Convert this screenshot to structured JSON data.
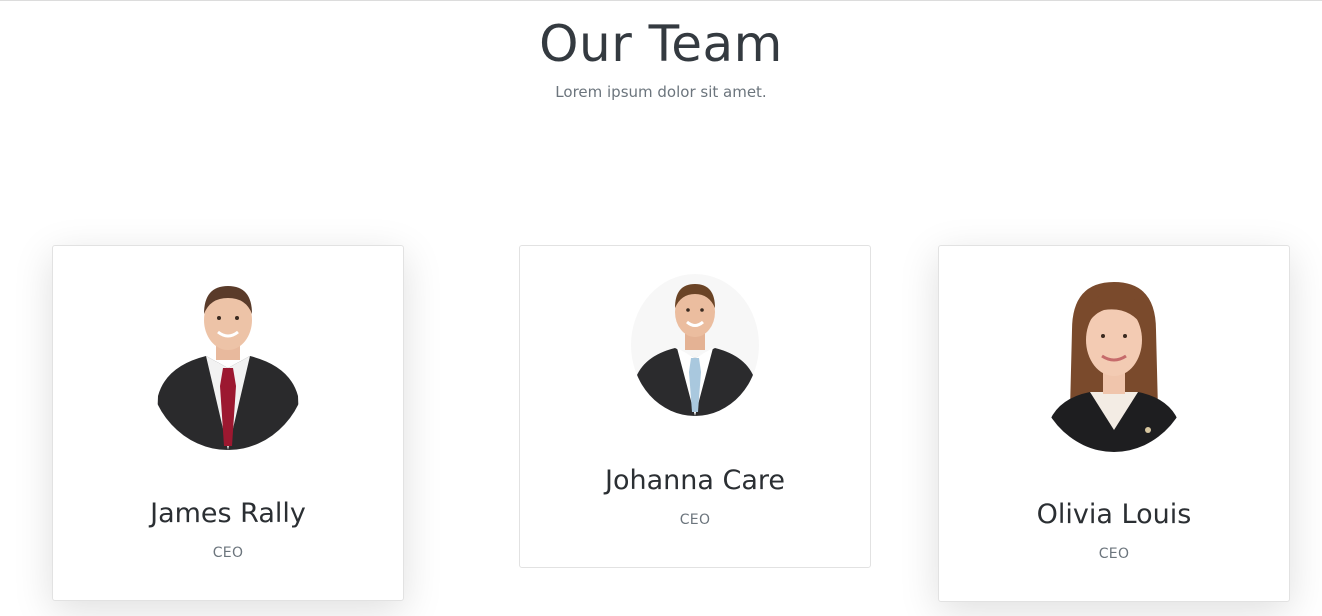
{
  "header": {
    "title": "Our Team",
    "subtitle": "Lorem ipsum dolor sit amet."
  },
  "team": [
    {
      "name": "James Rally",
      "role": "CEO",
      "photo": "man-portrait-red-tie"
    },
    {
      "name": "Johanna Care",
      "role": "CEO",
      "photo": "man-portrait-blue-tie"
    },
    {
      "name": "Olivia Louis",
      "role": "CEO",
      "photo": "woman-portrait"
    }
  ],
  "colors": {
    "title": "#343a40",
    "muted": "#6c757d",
    "card_border": "#e2e2e2"
  }
}
